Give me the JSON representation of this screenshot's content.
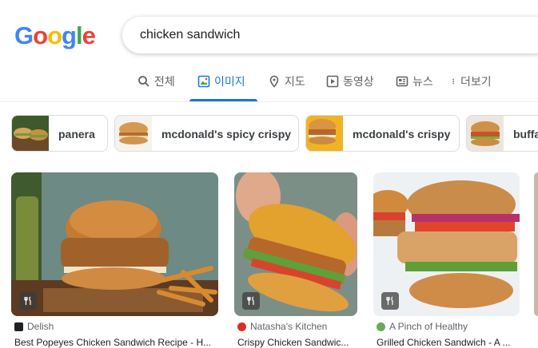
{
  "logo": {
    "letters": [
      "G",
      "o",
      "o",
      "g",
      "l",
      "e"
    ]
  },
  "search": {
    "query": "chicken sandwich"
  },
  "tabs": [
    {
      "label": "전체",
      "icon": "search-icon"
    },
    {
      "label": "이미지",
      "icon": "image-icon"
    },
    {
      "label": "지도",
      "icon": "map-pin-icon"
    },
    {
      "label": "동영상",
      "icon": "play-icon"
    },
    {
      "label": "뉴스",
      "icon": "news-icon"
    },
    {
      "label": "더보기",
      "icon": "more-vert-icon"
    }
  ],
  "active_tab": "이미지",
  "chips": [
    {
      "label": "panera"
    },
    {
      "label": "mcdonald's spicy crispy"
    },
    {
      "label": "mcdonald's crispy"
    },
    {
      "label": "buffa"
    }
  ],
  "results": [
    {
      "source": "Delish",
      "title": "Best Popeyes Chicken Sandwich Recipe - H..."
    },
    {
      "source": "Natasha's Kitchen",
      "title": "Crispy Chicken Sandwic..."
    },
    {
      "source": "A Pinch of Healthy",
      "title": "Grilled Chicken Sandwich - A ..."
    }
  ],
  "colors": {
    "accent": "#1a73e8",
    "g_blue": "#4285f4",
    "g_red": "#ea4335",
    "g_yellow": "#fbbc05",
    "g_green": "#34a853"
  }
}
